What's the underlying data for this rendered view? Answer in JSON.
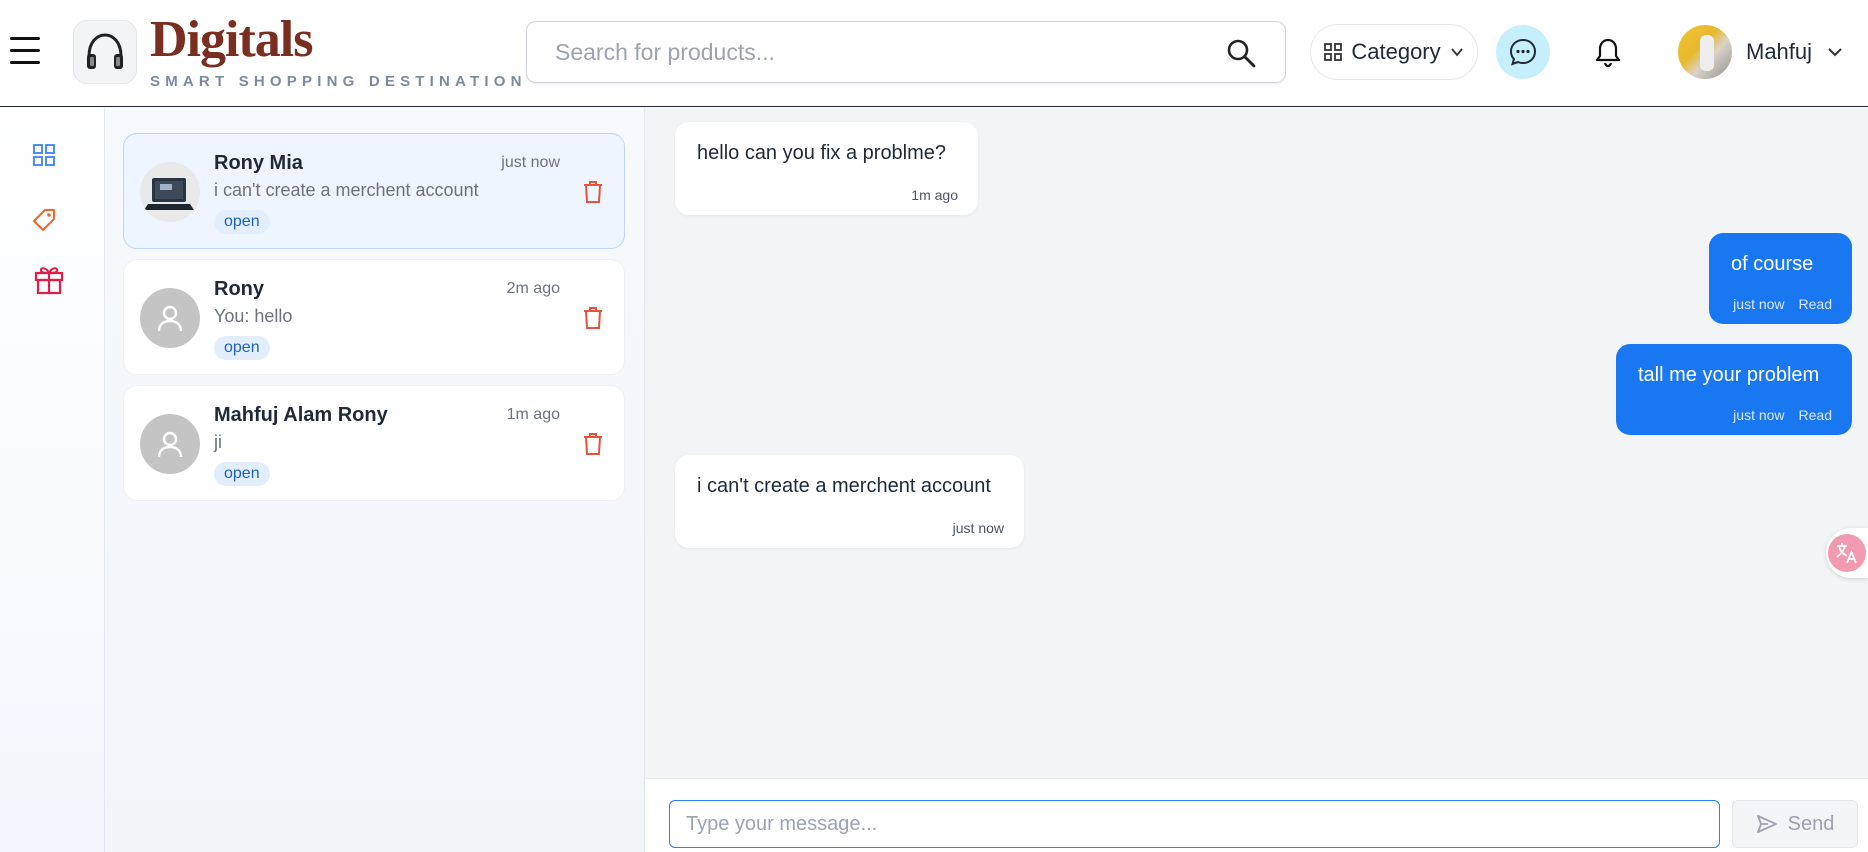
{
  "header": {
    "brand_name": "Digitals",
    "brand_tagline": "SMART SHOPPING DESTINATION",
    "search_placeholder": "Search for products...",
    "category_label": "Category",
    "user_name": "Mahfuj"
  },
  "sidebar": {
    "icons": [
      "grid-icon",
      "tag-icon",
      "gift-icon"
    ]
  },
  "conversations": [
    {
      "name": "Rony Mia",
      "time": "just now",
      "preview": "i can't create a merchent account",
      "status": "open",
      "active": true,
      "avatar": "photo"
    },
    {
      "name": "Rony",
      "time": "2m ago",
      "preview": "You: hello",
      "status": "open",
      "active": false,
      "avatar": "default-user"
    },
    {
      "name": "Mahfuj Alam Rony",
      "time": "1m ago",
      "preview": "ji",
      "status": "open",
      "active": false,
      "avatar": "default-user"
    }
  ],
  "messages": [
    {
      "direction": "in",
      "text": "hello can you fix a problme?",
      "time": "1m ago"
    },
    {
      "direction": "out",
      "text": "of course",
      "time": "just now",
      "receipt": "Read"
    },
    {
      "direction": "out",
      "text": "tall me your problem",
      "time": "just now",
      "receipt": "Read"
    },
    {
      "direction": "in",
      "text": "i can't create a merchent account",
      "time": "just now"
    }
  ],
  "composer": {
    "placeholder": "Type your message...",
    "send_label": "Send"
  },
  "colors": {
    "brand": "#7a2e20",
    "accent": "#1a77f2",
    "chat_btn_bg": "#c6effc",
    "delete": "#e5533d",
    "status_bg": "#e3eefc"
  }
}
